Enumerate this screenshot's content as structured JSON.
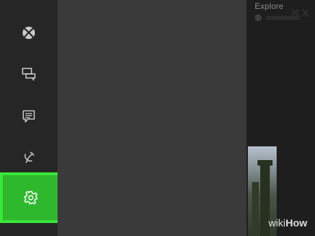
{
  "rail": {
    "items": [
      {
        "id": "xbox",
        "icon": "xbox-logo-icon"
      },
      {
        "id": "party",
        "icon": "party-chat-icon"
      },
      {
        "id": "messages",
        "icon": "messages-icon"
      },
      {
        "id": "broadcast",
        "icon": "broadcast-icon"
      }
    ],
    "settings": {
      "icon": "gear-icon",
      "highlight_color": "#2eb82e"
    }
  },
  "home": {
    "explore_label": "Explore"
  },
  "watermark": {
    "wiki": "wiki",
    "how": "How"
  },
  "colors": {
    "rail_bg": "#262626",
    "panel_bg": "#3a3a3a",
    "icon": "#c8c8c8",
    "highlight": "#2eb82e",
    "highlight_border": "#3ae83a"
  }
}
